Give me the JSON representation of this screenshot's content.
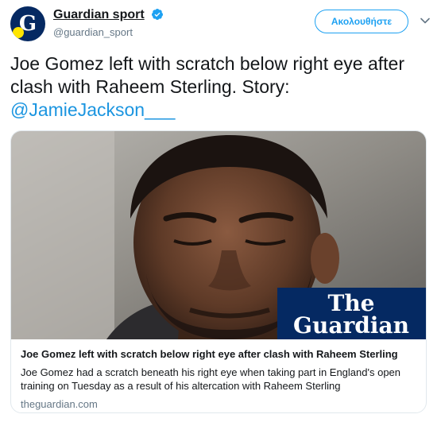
{
  "account": {
    "display_name": "Guardian sport",
    "handle": "@guardian_sport",
    "avatar_letter": "G",
    "brand_color": "#052962",
    "verified": true
  },
  "follow_button": {
    "label": "Ακολουθήστε"
  },
  "more_menu_icon": "chevron-down-icon",
  "tweet": {
    "text": "Joe Gomez left with scratch below right eye after clash with Raheem Sterling. Story: ",
    "mention": "@JamieJackson___"
  },
  "card": {
    "image_logo_line1": "The",
    "image_logo_line2": "Guardian",
    "title": "Joe Gomez left with scratch below right eye after clash with Raheem Sterling",
    "description": "Joe Gomez had a scratch beneath his right eye when taking part in England's open training on Tuesday as a result of his altercation with Raheem Sterling",
    "domain": "theguardian.com"
  },
  "colors": {
    "accent": "#1da1f2",
    "mention": "#1b95e0",
    "muted": "#657786",
    "logo_box": "#052962"
  }
}
